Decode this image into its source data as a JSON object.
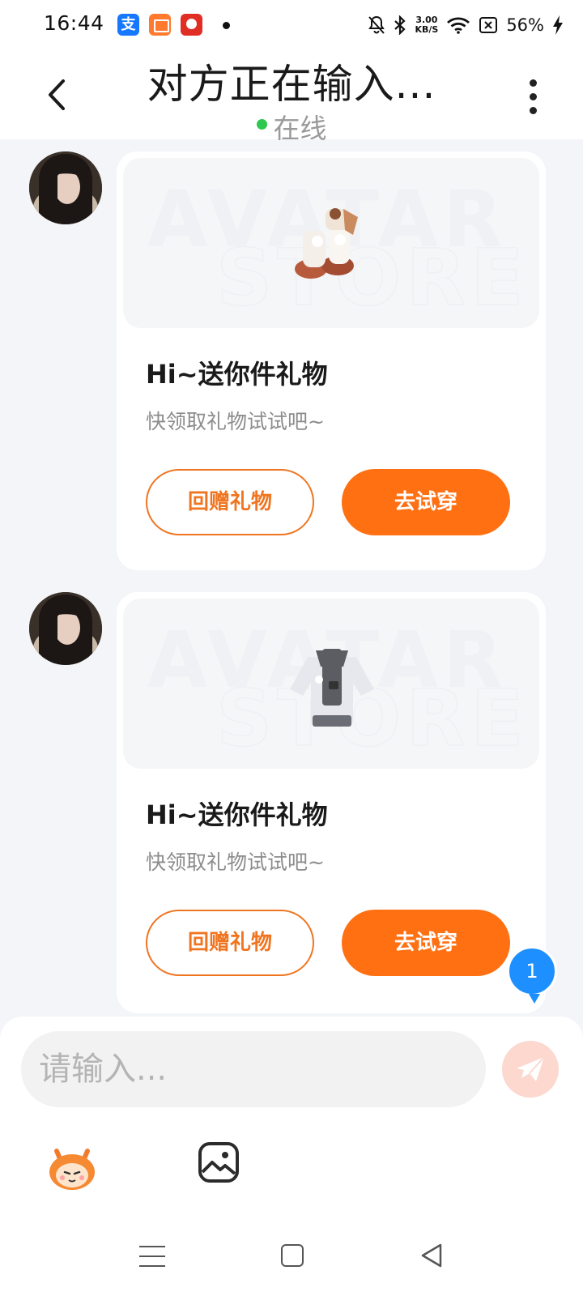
{
  "status_bar": {
    "time": "16:44",
    "net_speed_value": "3.00",
    "net_speed_unit": "KB/S",
    "battery": "56%",
    "icons": [
      "alipay-icon",
      "book-app-icon",
      "pdd-app-icon",
      "mute-bell-icon",
      "bluetooth-icon",
      "wifi-icon",
      "no-sim-icon",
      "charging-icon"
    ]
  },
  "header": {
    "title": "对方正在输入...",
    "status": "在线",
    "status_color": "#2DC84D"
  },
  "messages": [
    {
      "gift_item": "boots",
      "title": "Hi~送你件礼物",
      "subtitle": "快领取礼物试试吧~",
      "return_label": "回赠礼物",
      "try_label": "去试穿"
    },
    {
      "gift_item": "jacket",
      "title": "Hi~送你件礼物",
      "subtitle": "快领取礼物试试吧~",
      "return_label": "回赠礼物",
      "try_label": "去试穿"
    }
  ],
  "unread_count": "1",
  "composer": {
    "placeholder": "请输入..."
  },
  "colors": {
    "accent": "#FF7013",
    "badge": "#1E8FFF",
    "background": "#F3F5F8"
  }
}
